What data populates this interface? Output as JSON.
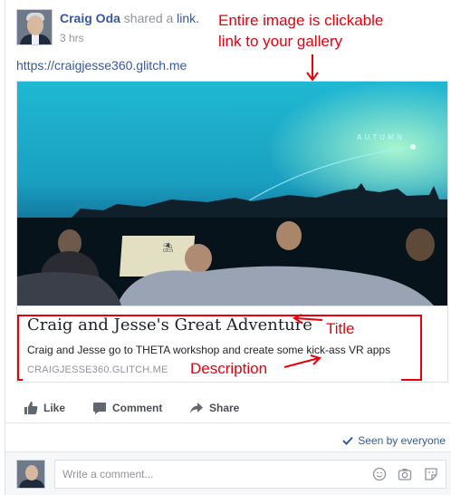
{
  "post": {
    "author_name": "Craig Oda",
    "action_text": "shared a",
    "action_link": "link.",
    "timestamp": "3 hrs",
    "url_text": "https://craigjesse360.glitch.me"
  },
  "card": {
    "title": "Craig and Jesse's Great Adventure",
    "description": "Craig and Jesse go to THETA workshop and create some kick-ass VR apps",
    "domain": "CRAIGJESSE360.GLITCH.ME",
    "image_overlay_text": "AUTUMN"
  },
  "actions": {
    "like_label": "Like",
    "comment_label": "Comment",
    "share_label": "Share"
  },
  "seen_by": "Seen by everyone",
  "comment_box": {
    "placeholder": "Write a comment..."
  },
  "annotations": {
    "image_note_line1": "Entire image is clickable",
    "image_note_line2": "link to your gallery",
    "title_note": "Title",
    "description_note": "Description"
  },
  "colors": {
    "link_blue": "#365899",
    "meta_gray": "#90949c",
    "annotation_red": "#e8000b"
  },
  "icons": [
    "like-icon",
    "comment-icon",
    "share-icon",
    "checkmark-icon",
    "emoji-icon",
    "camera-icon",
    "sticker-icon"
  ]
}
